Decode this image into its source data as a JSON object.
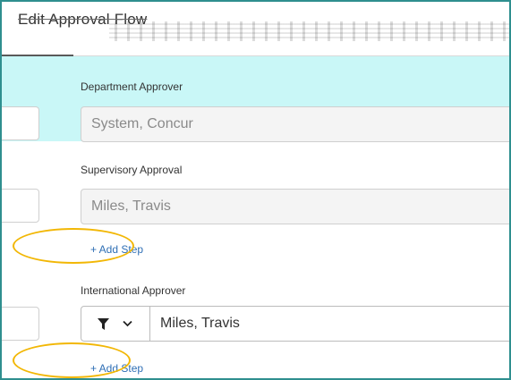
{
  "dialog": {
    "title": "Edit Approval Flow"
  },
  "steps": [
    {
      "label": "Department Approver",
      "approver_value": "System, Concur"
    },
    {
      "label": "Supervisory Approval",
      "approver_value": "Miles, Travis",
      "add_step_link": "+ Add Step"
    },
    {
      "label": "International Approver",
      "approver_value": "Miles, Travis",
      "add_step_link": "+ Add Step"
    }
  ],
  "icons": {
    "filter": "filter-icon",
    "dropdown": "chevron-down-icon"
  },
  "colors": {
    "highlight_band": "#c9f7f7",
    "annotation_circle": "#f2b705",
    "link": "#2f6fb5",
    "frame_border": "#2f8f8f"
  }
}
